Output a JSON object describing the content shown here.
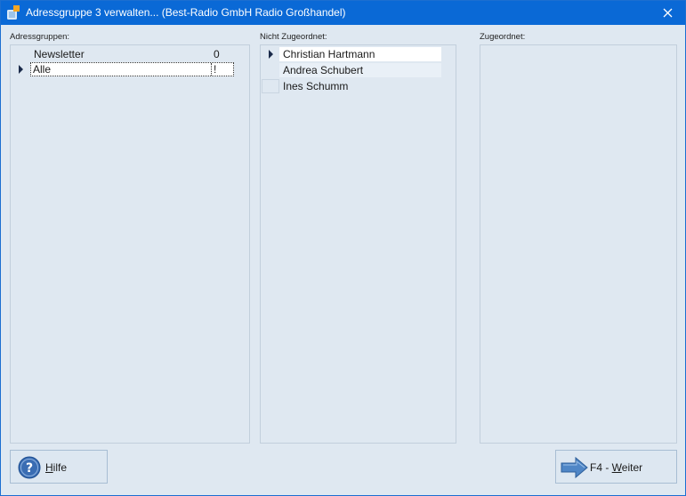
{
  "window": {
    "title": "Adressgruppe 3 verwalten... (Best-Radio GmbH Radio Großhandel)",
    "close_glyph": "✕"
  },
  "adressgruppen": {
    "label": "Adressgruppen:",
    "rows": [
      {
        "name": "Newsletter",
        "count": "0",
        "current": false
      },
      {
        "name": "Alle",
        "count": "!",
        "current": true
      }
    ]
  },
  "nicht_zugeordnet": {
    "label": "Nicht Zugeordnet:",
    "rows": [
      {
        "name": "Christian Hartmann",
        "current": true
      },
      {
        "name": "Andrea Schubert",
        "current": false
      },
      {
        "name": "Ines Schumm",
        "current": false
      }
    ]
  },
  "zugeordnet": {
    "label": "Zugeordnet:",
    "rows": []
  },
  "buttons": {
    "hilfe": {
      "mnemonic": "H",
      "rest": "ilfe"
    },
    "weiter": {
      "prefix": "F4 - ",
      "mnemonic": "W",
      "rest": "eiter"
    }
  },
  "colors": {
    "titlebar": "#0a69d6",
    "selected_row": "#ffffff",
    "alt_row": "#e9f0f7",
    "help_icon": "#3a6db3",
    "arrow_icon": "#4f86c6"
  }
}
